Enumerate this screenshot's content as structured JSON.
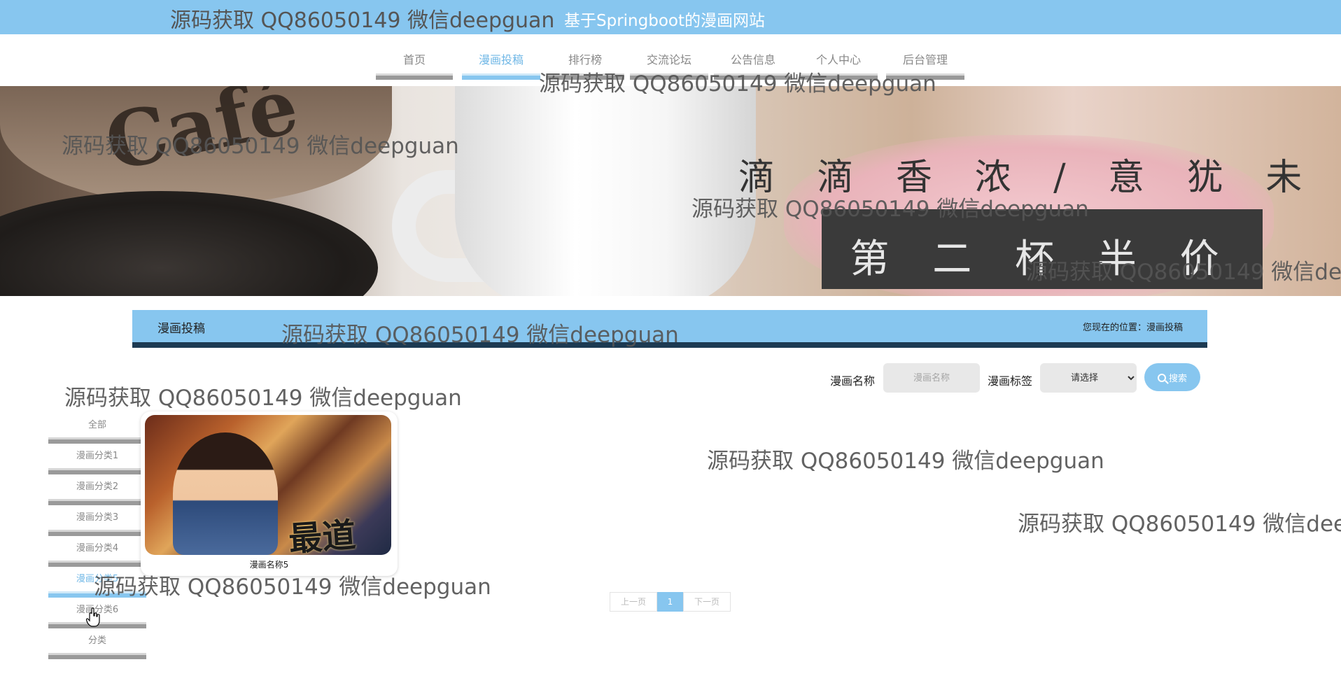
{
  "site": {
    "title": "基于Springboot的漫画网站"
  },
  "watermark": "源码获取 QQ86050149 微信deepguan",
  "nav": {
    "items": [
      {
        "label": "首页",
        "active": false
      },
      {
        "label": "漫画投稿",
        "active": true
      },
      {
        "label": "排行榜",
        "active": false
      },
      {
        "label": "交流论坛",
        "active": false
      },
      {
        "label": "公告信息",
        "active": false
      },
      {
        "label": "个人中心",
        "active": false
      },
      {
        "label": "后台管理",
        "active": false
      }
    ]
  },
  "banner": {
    "slogan": "滴 滴 香 浓 / 意 犹 未 尽",
    "promo": "第 二 杯 半 价",
    "cup_text": "Café"
  },
  "section": {
    "title": "漫画投稿",
    "breadcrumb": "您现在的位置：漫画投稿"
  },
  "search": {
    "name_label": "漫画名称",
    "name_placeholder": "漫画名称",
    "name_value": "",
    "tag_label": "漫画标签",
    "tag_selected": "请选择",
    "button_label": "搜索"
  },
  "categories": [
    {
      "label": "全部",
      "active": false
    },
    {
      "label": "漫画分类1",
      "active": false
    },
    {
      "label": "漫画分类2",
      "active": false
    },
    {
      "label": "漫画分类3",
      "active": false
    },
    {
      "label": "漫画分类4",
      "active": false
    },
    {
      "label": "漫画分类5",
      "active": true
    },
    {
      "label": "漫画分类6",
      "active": false
    },
    {
      "label": "分类",
      "active": false
    }
  ],
  "comics": [
    {
      "name": "漫画名称5",
      "cover_text": "最道"
    }
  ],
  "pagination": {
    "prev_label": "上一页",
    "current_page": "1",
    "next_label": "下一页"
  },
  "colors": {
    "accent": "#87c6ef",
    "section_border": "#1c3a52",
    "inactive_bar": "#9a9a9a"
  }
}
